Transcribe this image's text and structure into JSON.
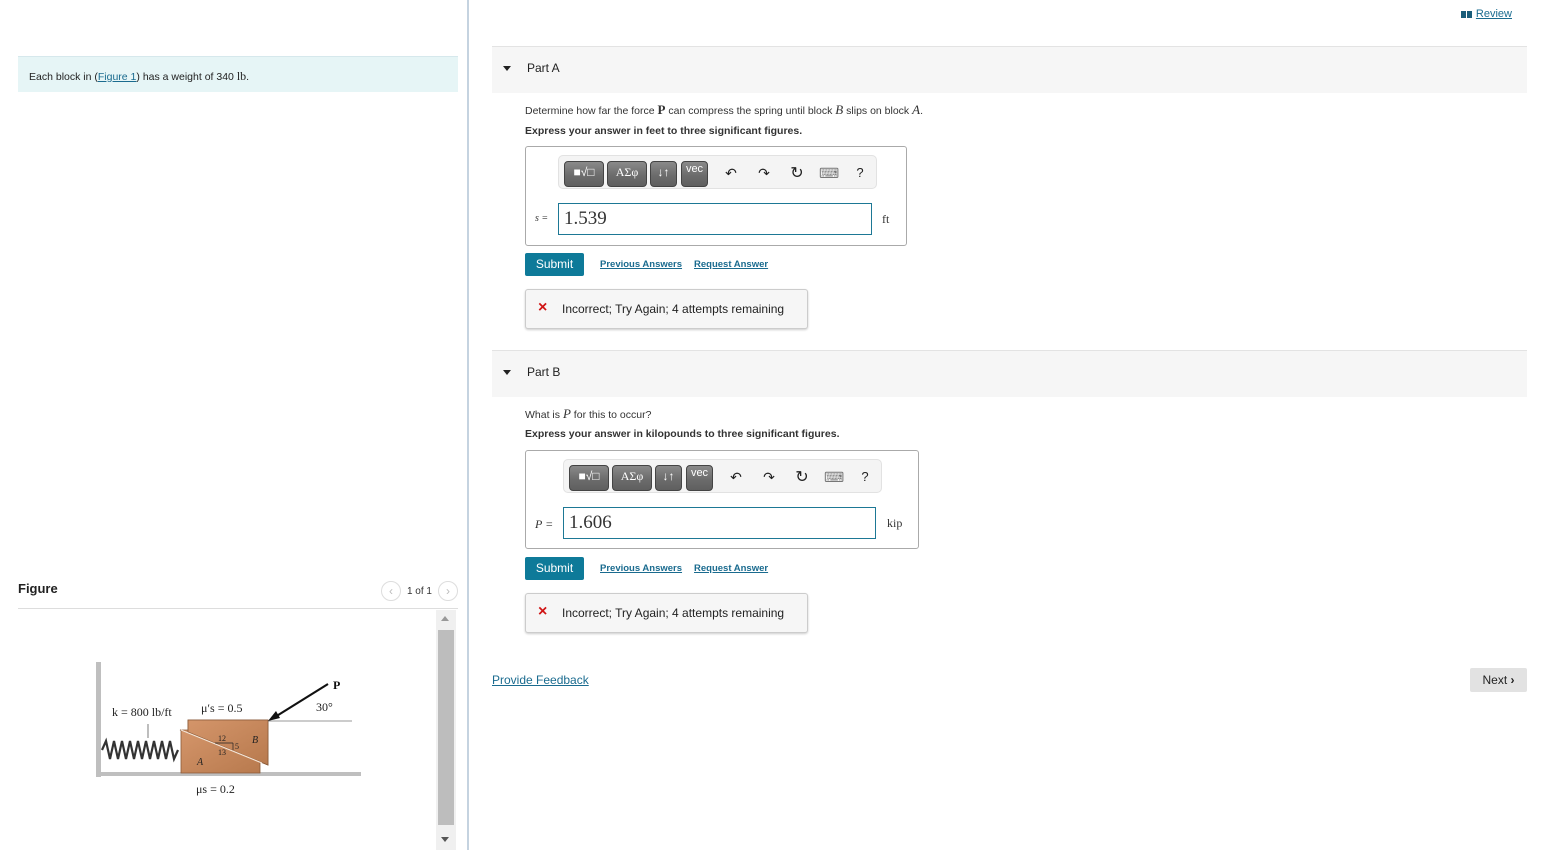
{
  "review": {
    "label": "Review",
    "icon": "book-icon"
  },
  "intro": {
    "text_before": "Each block in (",
    "figure_link": "Figure 1",
    "text_after": ") has a weight of 340 ",
    "unit": "lb",
    "period": "."
  },
  "figure": {
    "title": "Figure",
    "counter": "1 of 1",
    "prev_icon": "chevron-left-icon",
    "next_icon": "chevron-right-icon",
    "labels": {
      "k": "k = 800 lb/ft",
      "mu_top": "μ′s = 0.5",
      "mu_bottom": "μs = 0.2",
      "force": "P",
      "angle": "30°",
      "block_a": "A",
      "block_b": "B",
      "slope_run": "12",
      "slope_rise": "5",
      "slope_hyp": "13"
    }
  },
  "parts": [
    {
      "title": "Part A",
      "question_before": "Determine how far the force ",
      "question_sym1": "P",
      "question_mid": " can compress the spring until block ",
      "question_sym2": "B",
      "question_mid2": " slips on block ",
      "question_sym3": "A",
      "question_after": ".",
      "instruction": "Express your answer in feet to three significant figures.",
      "toolbar": {
        "templates": "■√□",
        "greek": "ΑΣφ",
        "arrows": "↓↑",
        "vec": "vec",
        "undo": "↶",
        "redo": "↷",
        "reset": "↻",
        "keyboard": "⌨",
        "help": "?"
      },
      "var_label": "s =",
      "value": "1.539",
      "unit": "ft",
      "submit": "Submit",
      "previous_answers": "Previous Answers",
      "request_answer": "Request Answer",
      "feedback_icon": "×",
      "feedback": "Incorrect; Try Again; 4 attempts remaining"
    },
    {
      "title": "Part B",
      "question_before": "What is ",
      "question_sym1": "P",
      "question_after": " for this to occur?",
      "instruction": "Express your answer in kilopounds to three significant figures.",
      "toolbar": {
        "templates": "■√□",
        "greek": "ΑΣφ",
        "arrows": "↓↑",
        "vec": "vec",
        "undo": "↶",
        "redo": "↷",
        "reset": "↻",
        "keyboard": "⌨",
        "help": "?"
      },
      "var_label": "P =",
      "value": "1.606",
      "unit": "kip",
      "submit": "Submit",
      "previous_answers": "Previous Answers",
      "request_answer": "Request Answer",
      "feedback_icon": "×",
      "feedback": "Incorrect; Try Again; 4 attempts remaining"
    }
  ],
  "footer": {
    "provide_feedback": "Provide Feedback",
    "next": "Next",
    "next_icon": "›"
  },
  "colors": {
    "accent": "#0e7a99",
    "link": "#1a6b8f",
    "error": "#d01414",
    "intro_bg": "#e6f5f6",
    "block": "#c8875a"
  }
}
